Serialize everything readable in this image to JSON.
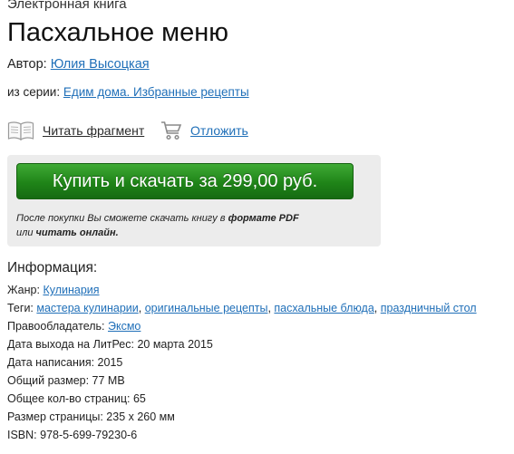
{
  "book": {
    "type": "Электронная книга",
    "title": "Пасхальное меню",
    "author_label": "Автор:",
    "author": "Юлия Высоцкая",
    "series_label": "из серии:",
    "series": "Едим дома. Избранные рецепты"
  },
  "actions": {
    "read_fragment": "Читать фрагмент",
    "defer": "Отложить"
  },
  "purchase": {
    "button_label": "Купить и скачать за 299,00 руб.",
    "note_prefix": "После покупки Вы сможете скачать книгу в ",
    "note_format": "формате PDF",
    "note_middle": " или ",
    "note_online": "читать онлайн.",
    "button_color": "#1f8418"
  },
  "info": {
    "heading": "Информация:",
    "genre_label": "Жанр:",
    "genre": "Кулинария",
    "tags_label": "Теги:",
    "tags": [
      "мастера кулинарии",
      "оригинальные рецепты",
      "пасхальные блюда",
      "праздничный стол"
    ],
    "tag_separator": ", ",
    "rightholder_label": "Правообладатель:",
    "rightholder": "Эксмо",
    "litres_release": "Дата выхода на ЛитРес: 20 марта 2015",
    "written_date": "Дата написания: 2015",
    "total_size": "Общий размер: 77 MB",
    "page_count": "Общее кол-во страниц: 65",
    "page_size": "Размер страницы: 235 x 260 мм",
    "isbn": "ISBN: 978-5-699-79230-6"
  },
  "icons": {
    "read": "open-book-icon",
    "defer": "shopping-cart-icon"
  },
  "colors": {
    "link": "#1f6fb8",
    "panel": "#ececec"
  }
}
